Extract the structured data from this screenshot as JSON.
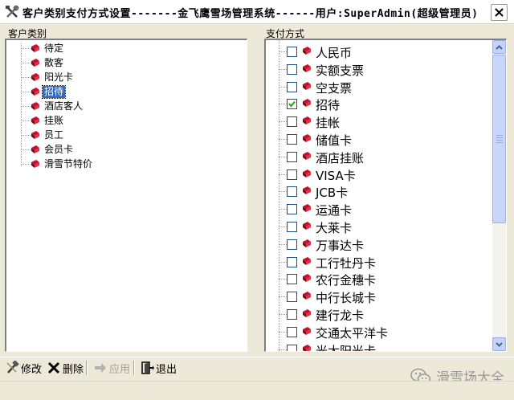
{
  "window": {
    "title": "客户类别支付方式设置-------金飞鹰雪场管理系统------用户:SuperAdmin(超级管理员)"
  },
  "left_panel": {
    "label": "客户类别",
    "items": [
      {
        "label": "待定",
        "selected": false
      },
      {
        "label": "散客",
        "selected": false
      },
      {
        "label": "阳光卡",
        "selected": false
      },
      {
        "label": "招待",
        "selected": true
      },
      {
        "label": "酒店客人",
        "selected": false
      },
      {
        "label": "挂账",
        "selected": false
      },
      {
        "label": "员工",
        "selected": false
      },
      {
        "label": "会员卡",
        "selected": false
      },
      {
        "label": "滑雪节特价",
        "selected": false
      }
    ]
  },
  "right_panel": {
    "label": "支付方式",
    "items": [
      {
        "label": "人民币",
        "checked": false
      },
      {
        "label": "实额支票",
        "checked": false
      },
      {
        "label": "空支票",
        "checked": false
      },
      {
        "label": "招待",
        "checked": true
      },
      {
        "label": "挂帐",
        "checked": false
      },
      {
        "label": "储值卡",
        "checked": false
      },
      {
        "label": "酒店挂账",
        "checked": false
      },
      {
        "label": "VISA卡",
        "checked": false
      },
      {
        "label": "JCB卡",
        "checked": false
      },
      {
        "label": "运通卡",
        "checked": false
      },
      {
        "label": "大莱卡",
        "checked": false
      },
      {
        "label": "万事达卡",
        "checked": false
      },
      {
        "label": "工行牡丹卡",
        "checked": false
      },
      {
        "label": "农行金穗卡",
        "checked": false
      },
      {
        "label": "中行长城卡",
        "checked": false
      },
      {
        "label": "建行龙卡",
        "checked": false
      },
      {
        "label": "交通太平洋卡",
        "checked": false
      },
      {
        "label": "光大阳光卡",
        "checked": false
      }
    ]
  },
  "toolbar": {
    "modify_label": "修改",
    "delete_label": "删除",
    "apply_label": "应用",
    "exit_label": "退出"
  },
  "watermark": {
    "text": "滑雪场大全"
  },
  "colors": {
    "selection": "#316ac5",
    "book_icon": "#c8102e",
    "window_bg": "#ece9d8"
  }
}
